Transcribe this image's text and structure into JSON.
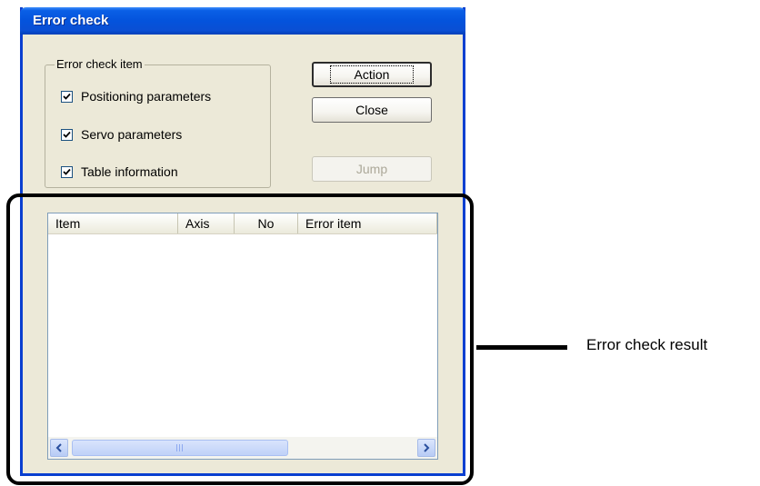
{
  "window": {
    "title": "Error check"
  },
  "group": {
    "legend": "Error check item",
    "items": [
      {
        "label": "Positioning parameters",
        "checked": true
      },
      {
        "label": "Servo parameters",
        "checked": true
      },
      {
        "label": "Table information",
        "checked": true
      }
    ]
  },
  "buttons": {
    "action": "Action",
    "close": "Close",
    "jump": "Jump"
  },
  "list": {
    "columns": [
      "Item",
      "Axis",
      "No",
      "Error item"
    ],
    "rows": []
  },
  "annotation": {
    "label": "Error check result"
  }
}
